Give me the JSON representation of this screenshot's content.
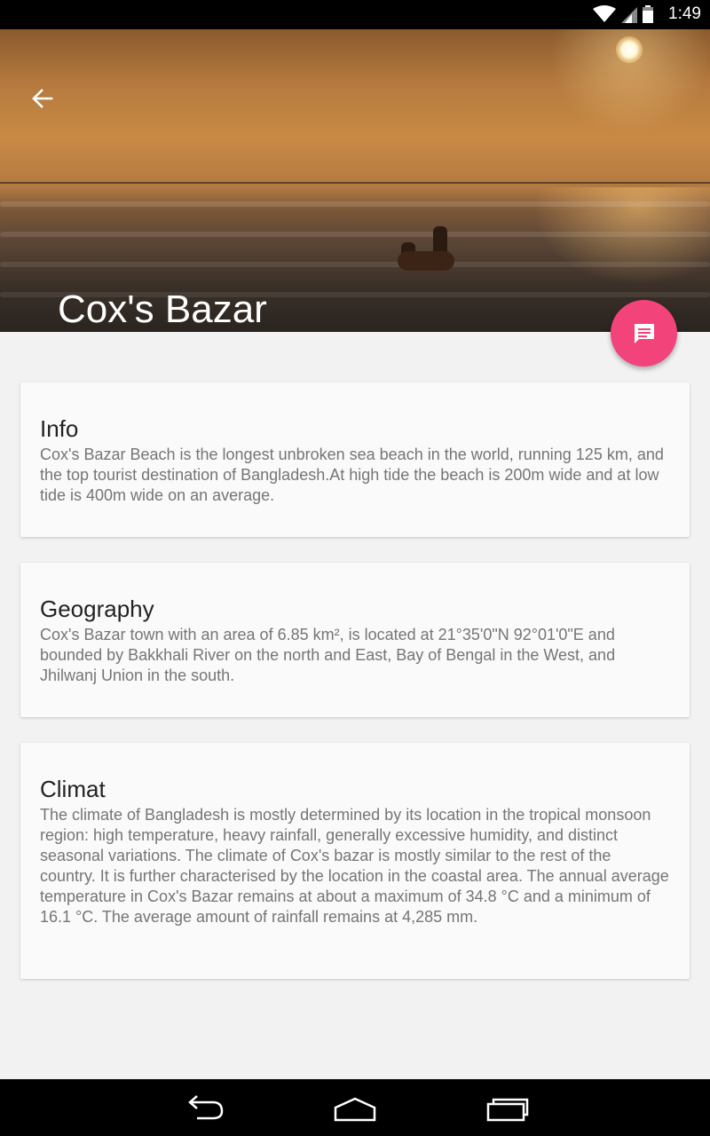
{
  "status_bar": {
    "time": "1:49",
    "icons": [
      "wifi-icon",
      "signal-icon",
      "battery-icon"
    ]
  },
  "hero": {
    "title": "Cox's Bazar",
    "back_icon": "arrow-left-icon"
  },
  "fab": {
    "icon": "message-icon",
    "color": "#f2437b"
  },
  "cards": [
    {
      "title": "Info",
      "body": "Cox's Bazar Beach is the longest unbroken sea beach in the world, running 125 km, and the top tourist destination of Bangladesh.At high tide the beach is 200m wide and at low tide is 400m wide on an average."
    },
    {
      "title": "Geography",
      "body": "Cox's Bazar town with an area of 6.85 km², is located at 21°35'0\"N 92°01'0\"E and bounded by Bakkhali River on the north and East, Bay of Bengal in the West, and Jhilwanj Union in the south."
    },
    {
      "title": "Climat",
      "body": "The climate of Bangladesh is mostly determined by its location in the tropical monsoon region: high temperature, heavy rainfall, generally excessive humidity, and distinct seasonal variations. The climate of Cox's bazar is mostly similar to the rest of the country. It is further characterised by the location in the coastal area. The annual average temperature in Cox's Bazar remains at about a maximum of 34.8 °C and a minimum of 16.1 °C. The average amount of rainfall remains at 4,285 mm."
    }
  ],
  "nav_bar": {
    "icons": [
      "back-nav-icon",
      "home-nav-icon",
      "recents-nav-icon"
    ]
  }
}
